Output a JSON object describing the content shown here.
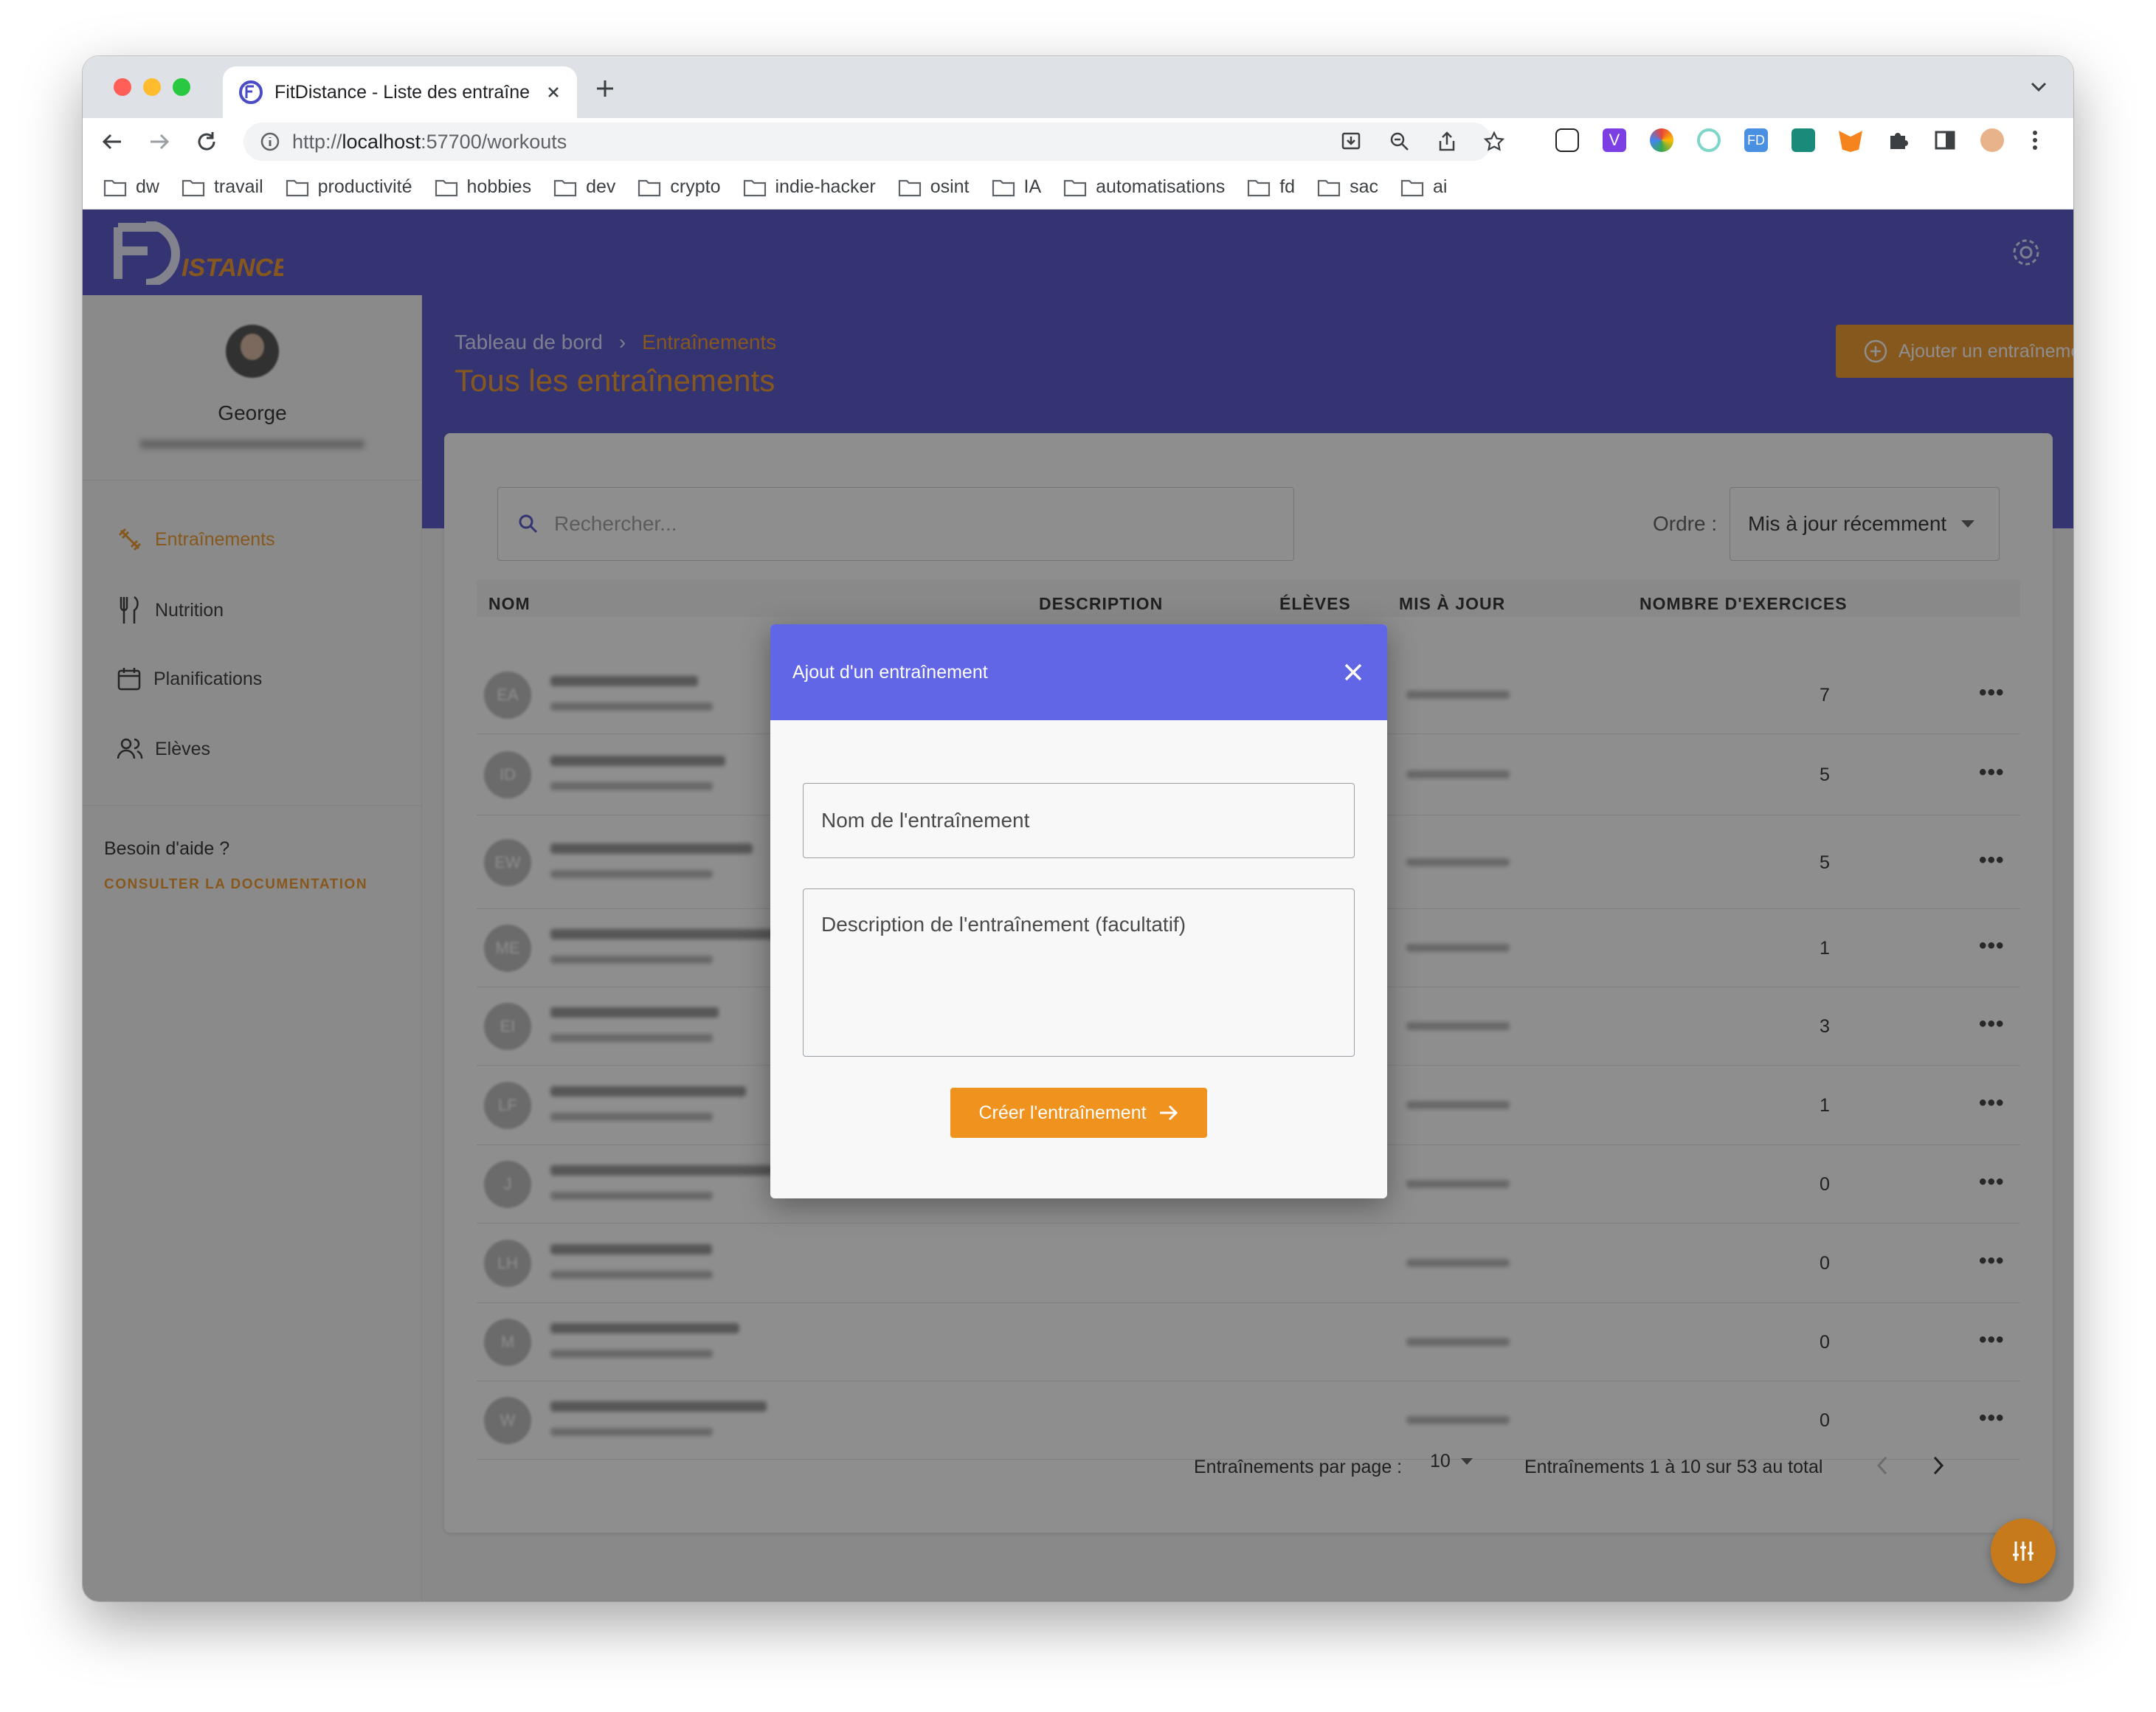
{
  "browser": {
    "tab_title": "FitDistance - Liste des entraîne",
    "url_scheme": "http://",
    "url_host": "localhost",
    "url_path": ":57700/workouts",
    "bookmarks": [
      "dw",
      "travail",
      "productivité",
      "hobbies",
      "dev",
      "crypto",
      "indie-hacker",
      "osint",
      "IA",
      "automatisations",
      "fd",
      "sac",
      "ai"
    ]
  },
  "app": {
    "logo_text": "ISTANCE",
    "logo_letters": "FD"
  },
  "sidebar": {
    "user_name": "George",
    "nav": [
      "Entraînements",
      "Nutrition",
      "Planifications",
      "Elèves"
    ],
    "help_title": "Besoin d'aide ?",
    "help_link": "CONSULTER LA DOCUMENTATION"
  },
  "hero": {
    "breadcrumb_home": "Tableau de bord",
    "breadcrumb_sep": "›",
    "breadcrumb_current": "Entraînements",
    "page_title": "Tous les entraînements",
    "add_button": "Ajouter un entraînement"
  },
  "list": {
    "search_placeholder": "Rechercher...",
    "order_label": "Ordre :",
    "order_value": "Mis à jour récemment",
    "columns": [
      "NOM",
      "DESCRIPTION",
      "ÉLÈVES",
      "MIS À JOUR",
      "NOMBRE D'EXERCICES"
    ],
    "rows": [
      {
        "initials": "EA",
        "count": "7"
      },
      {
        "initials": "ID",
        "count": "5"
      },
      {
        "initials": "EW",
        "count": "5"
      },
      {
        "initials": "ME",
        "count": "1"
      },
      {
        "initials": "EI",
        "count": "3"
      },
      {
        "initials": "LF",
        "count": "1"
      },
      {
        "initials": "J",
        "count": "0"
      },
      {
        "initials": "LH",
        "count": "0"
      },
      {
        "initials": "M",
        "count": "0"
      },
      {
        "initials": "W",
        "count": "0"
      }
    ],
    "row_menu": "•••",
    "per_page_label": "Entraînements par page :",
    "per_page_value": "10",
    "range_text": "Entraînements 1 à 10 sur 53 au total"
  },
  "modal": {
    "title": "Ajout d'un entraînement",
    "name_placeholder": "Nom de l'entraînement",
    "description_placeholder": "Description de l'entraînement (facultatif)",
    "submit": "Créer l'entraînement"
  },
  "colors": {
    "primary": "#4b4bc6",
    "modal_header": "#6066e6",
    "accent": "#f0921e"
  },
  "icons": {
    "close": "close-icon",
    "arrow": "arrow-right-icon",
    "settings": "gear-icon",
    "search": "search-icon"
  }
}
